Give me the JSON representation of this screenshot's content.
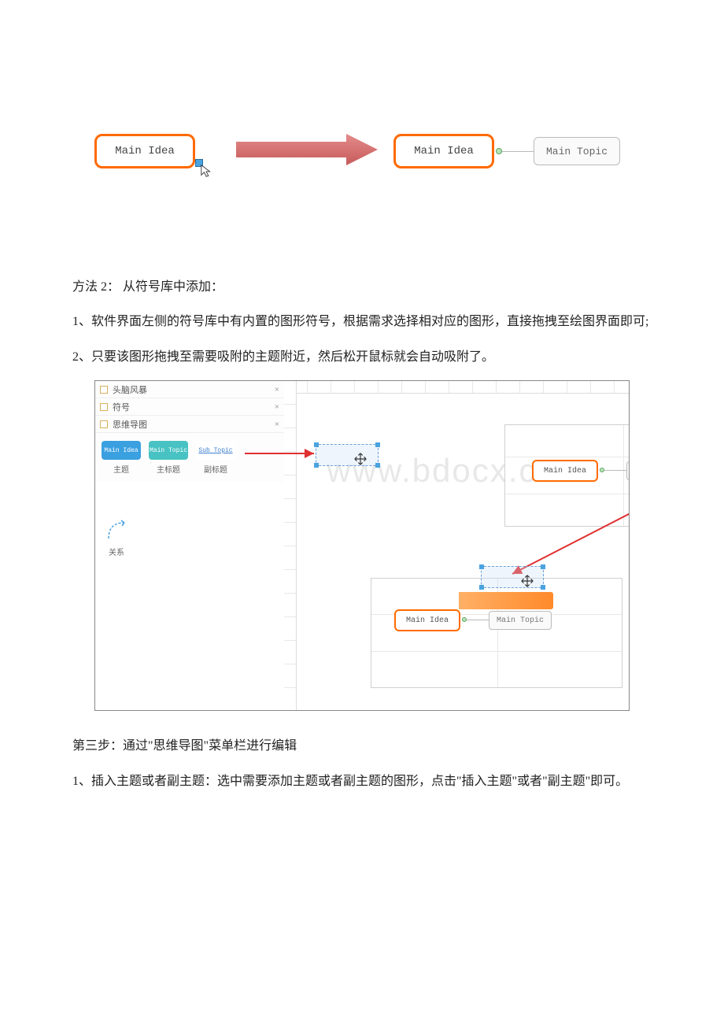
{
  "diagram": {
    "main_idea": "Main Idea",
    "main_topic": "Main Topic"
  },
  "method2_heading": "方法 2：  从符号库中添加：",
  "method2_p1": "1、软件界面左侧的符号库中有内置的图形符号，根据需求选择相对应的图形，直接拖拽至绘图界面即可;",
  "method2_p2": "2、只要该图形拖拽至需要吸附的主题附近，然后松开鼠标就会自动吸附了。",
  "screenshot": {
    "panel_rows": [
      "头脑风暴",
      "符号",
      "思维导图"
    ],
    "palette": [
      {
        "box_label": "Main Idea",
        "label": "主题"
      },
      {
        "box_label": "Main Topic",
        "label": "主标题"
      },
      {
        "box_label": "Sub Topic",
        "label": "副标题"
      }
    ],
    "relation_label": "关系",
    "main_idea": "Main Idea",
    "main_topic": "Main Topic",
    "watermark": "www.bdocx.com"
  },
  "step3_heading": "第三步：通过\"思维导图\"菜单栏进行编辑",
  "step3_p1": "1、插入主题或者副主题：选中需要添加主题或者副主题的图形，点击\"插入主题\"或者\"副主题\"即可。"
}
